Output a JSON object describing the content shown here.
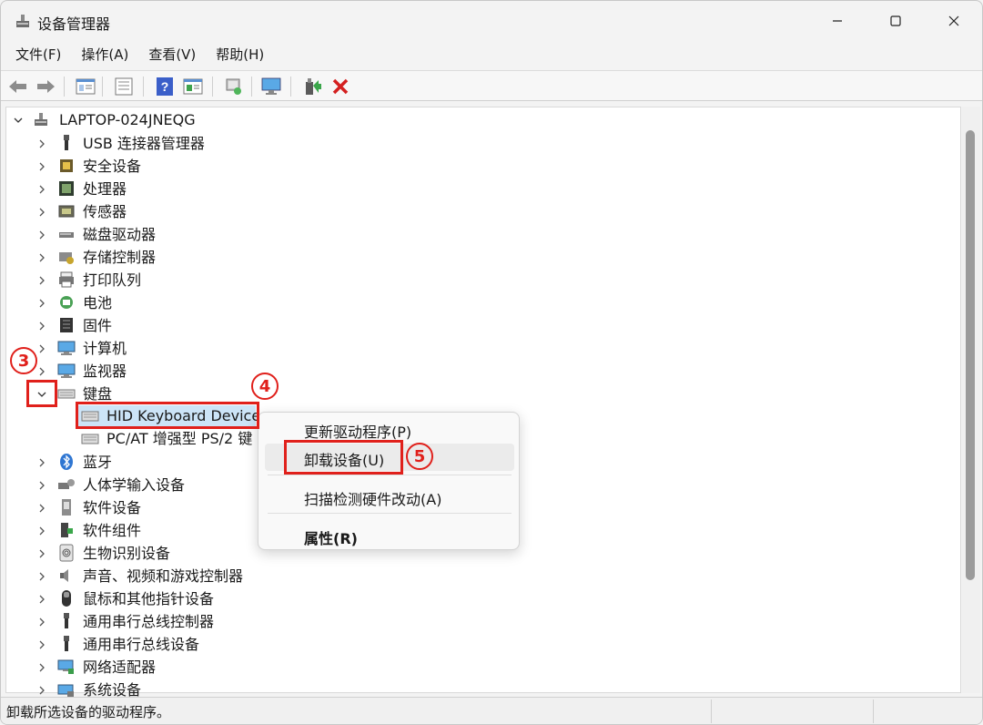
{
  "window": {
    "title": "设备管理器"
  },
  "menubar": [
    "文件(F)",
    "操作(A)",
    "查看(V)",
    "帮助(H)"
  ],
  "toolbar": {
    "icons": [
      "back-arrow-icon",
      "forward-arrow-icon",
      "properties-sheet-icon",
      "device-list-icon",
      "help-icon",
      "view-icon",
      "scan-hardware-icon",
      "monitor-icon",
      "update-driver-icon",
      "uninstall-x-icon"
    ]
  },
  "tree": {
    "root": "LAPTOP-024JNEQG",
    "items": [
      {
        "label": "USB 连接器管理器",
        "icon": "usb-icon",
        "expanded": false
      },
      {
        "label": "安全设备",
        "icon": "security-device-icon",
        "expanded": false
      },
      {
        "label": "处理器",
        "icon": "processor-icon",
        "expanded": false
      },
      {
        "label": "传感器",
        "icon": "sensor-icon",
        "expanded": false
      },
      {
        "label": "磁盘驱动器",
        "icon": "disk-drive-icon",
        "expanded": false
      },
      {
        "label": "存储控制器",
        "icon": "storage-controller-icon",
        "expanded": false
      },
      {
        "label": "打印队列",
        "icon": "printer-icon",
        "expanded": false
      },
      {
        "label": "电池",
        "icon": "battery-icon",
        "expanded": false
      },
      {
        "label": "固件",
        "icon": "firmware-icon",
        "expanded": false
      },
      {
        "label": "计算机",
        "icon": "computer-icon",
        "expanded": false
      },
      {
        "label": "监视器",
        "icon": "monitor-icon",
        "expanded": false
      },
      {
        "label": "键盘",
        "icon": "keyboard-icon",
        "expanded": true,
        "children": [
          {
            "label": "HID Keyboard Device",
            "icon": "keyboard-icon",
            "selected": true
          },
          {
            "label": "PC/AT 增强型 PS/2 键",
            "icon": "keyboard-icon"
          }
        ]
      },
      {
        "label": "蓝牙",
        "icon": "bluetooth-icon",
        "expanded": false
      },
      {
        "label": "人体学输入设备",
        "icon": "hid-icon",
        "expanded": false
      },
      {
        "label": "软件设备",
        "icon": "software-device-icon",
        "expanded": false
      },
      {
        "label": "软件组件",
        "icon": "software-component-icon",
        "expanded": false
      },
      {
        "label": "生物识别设备",
        "icon": "biometric-icon",
        "expanded": false
      },
      {
        "label": "声音、视频和游戏控制器",
        "icon": "sound-icon",
        "expanded": false
      },
      {
        "label": "鼠标和其他指针设备",
        "icon": "mouse-icon",
        "expanded": false
      },
      {
        "label": "通用串行总线控制器",
        "icon": "usb-icon",
        "expanded": false
      },
      {
        "label": "通用串行总线设备",
        "icon": "usb-icon",
        "expanded": false
      },
      {
        "label": "网络适配器",
        "icon": "network-adapter-icon",
        "expanded": false
      },
      {
        "label": "系统设备",
        "icon": "system-device-icon",
        "expanded": false
      }
    ]
  },
  "context_menu": {
    "items": [
      "更新驱动程序(P)",
      "卸载设备(U)",
      "扫描检测硬件改动(A)",
      "属性(R)"
    ]
  },
  "annotations": {
    "step3": "3",
    "step4": "4",
    "step5": "5"
  },
  "statusbar": {
    "text": "卸载所选设备的驱动程序。"
  },
  "colors": {
    "annotation": "#e0201b",
    "selection": "#cce4f7",
    "uninstall": "#d42020"
  }
}
